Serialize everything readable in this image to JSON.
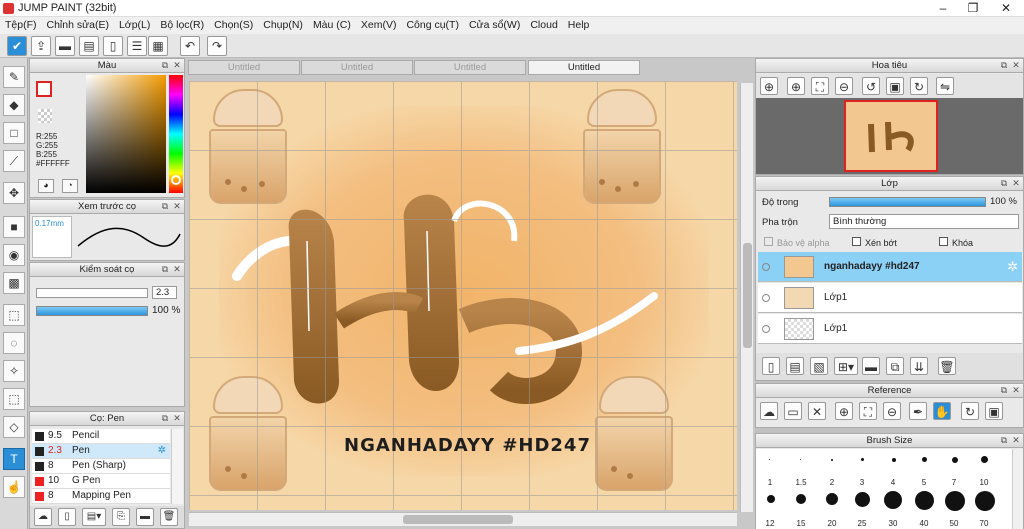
{
  "window": {
    "title": "JUMP PAINT (32bit)",
    "controls": [
      "–",
      "❐",
      "✕"
    ]
  },
  "menu": [
    "Tệp(F)",
    "Chỉnh sửa(E)",
    "Lớp(L)",
    "Bộ lọc(R)",
    "Chọn(S)",
    "Chụp(N)",
    "Màu (C)",
    "Xem(V)",
    "Công cụ(T)",
    "Cửa sổ(W)",
    "Cloud",
    "Help"
  ],
  "tabs": [
    "Untitled",
    "Untitled",
    "Untitled",
    "Untitled"
  ],
  "color_panel": {
    "title": "Màu",
    "r": "R:255",
    "g": "G:255",
    "b": "B:255",
    "hex": "#FFFFFF"
  },
  "preview_panel": {
    "title": "Xem trước cọ",
    "size": "0.17mm"
  },
  "control_panel": {
    "title": "Kiểm soát cọ",
    "size_value": "2.3",
    "opacity_value": "100 %"
  },
  "brush_panel": {
    "title": "Cọ: Pen",
    "brushes": [
      {
        "size": "9.5",
        "name": "Pencil"
      },
      {
        "size": "2.3",
        "name": "Pen"
      },
      {
        "size": "8",
        "name": "Pen (Sharp)"
      },
      {
        "size": "10",
        "name": "G Pen"
      },
      {
        "size": "8",
        "name": "Mapping Pen"
      }
    ]
  },
  "artwork": {
    "caption": "NGANHADAYY #HD247"
  },
  "navigator": {
    "title": "Hoa tiêu"
  },
  "layers_panel": {
    "title": "Lớp",
    "opacity_label": "Độ trong",
    "opacity_value": "100 %",
    "blend_label": "Pha trộn",
    "blend_value": "Bình thường",
    "protect_alpha": "Bảo vệ alpha",
    "clip": "Xén bớt",
    "lock": "Khóa",
    "layers": [
      {
        "name": "nganhadayy #hd247",
        "selected": true
      },
      {
        "name": "Lớp1",
        "selected": false
      },
      {
        "name": "Lớp1",
        "selected": false
      }
    ]
  },
  "reference_panel": {
    "title": "Reference"
  },
  "brush_size_panel": {
    "title": "Brush Size",
    "row1": [
      ".",
      ".",
      ".",
      ".",
      ".",
      ".",
      "."
    ],
    "labels1": [
      "1",
      "1.5",
      "2",
      "3",
      "4",
      "5",
      "7",
      "10"
    ],
    "labels2": [
      "12",
      "15",
      "20",
      "25",
      "30",
      "40",
      "50",
      "70"
    ]
  }
}
